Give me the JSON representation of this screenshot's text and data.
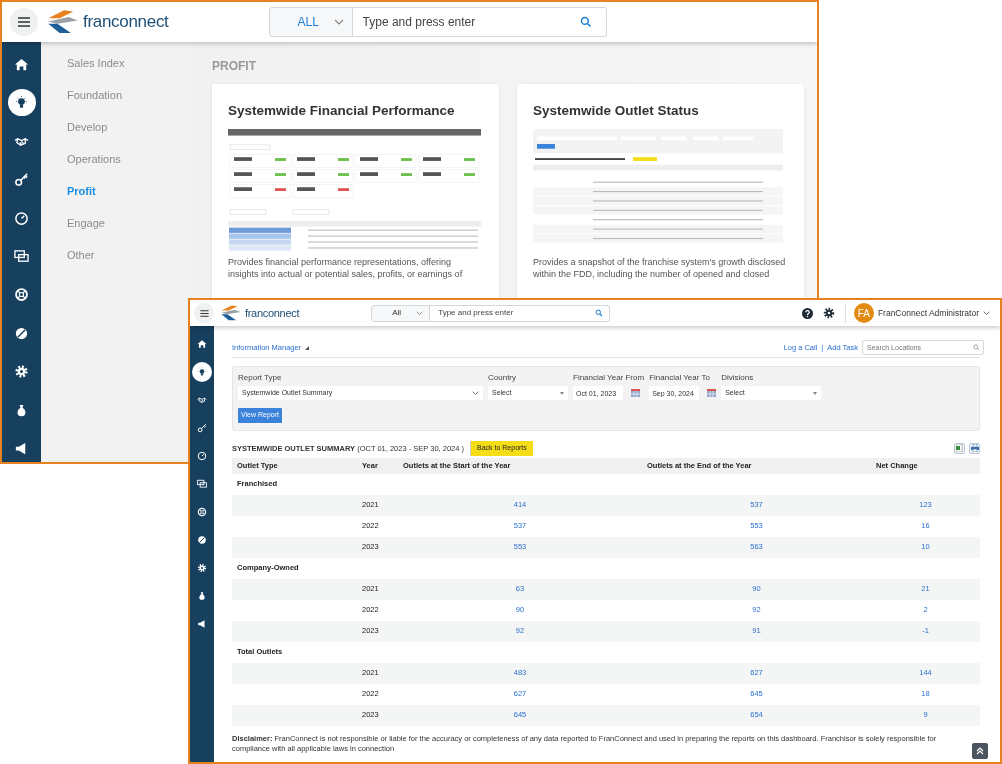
{
  "back_window": {
    "logo_text": "franconnect",
    "search": {
      "scope": "ALL",
      "placeholder": "Type and press enter"
    },
    "sidebar": [
      {
        "selected": false
      },
      {
        "selected": true
      },
      {
        "selected": false
      },
      {
        "selected": false
      },
      {
        "selected": false
      },
      {
        "selected": false
      },
      {
        "selected": false
      },
      {
        "selected": false
      },
      {
        "selected": false
      },
      {
        "selected": false
      },
      {
        "selected": false
      }
    ],
    "nav": [
      {
        "label": "Sales Index",
        "selected": false
      },
      {
        "label": "Foundation",
        "selected": false
      },
      {
        "label": "Develop",
        "selected": false
      },
      {
        "label": "Operations",
        "selected": false
      },
      {
        "label": "Profit",
        "selected": true
      },
      {
        "label": "Engage",
        "selected": false
      },
      {
        "label": "Other",
        "selected": false
      }
    ],
    "section_title": "PROFIT",
    "cards": [
      {
        "title": "Systemwide Financial Performance",
        "kind": "kpi",
        "description": "Provides financial performance representations, offering insights into actual or potential sales, profits, or earnings of"
      },
      {
        "title": "Systemwide Outlet Status",
        "kind": "table",
        "description": "Provides a snapshot of the franchise system's growth disclosed within the FDD, including the number of opened and closed"
      }
    ]
  },
  "front_window": {
    "logo_text": "franconnect",
    "search": {
      "scope": "All",
      "placeholder": "Type and press enter"
    },
    "user": {
      "initials": "FA",
      "name": "FranConnect Administrator"
    },
    "sidebar": [
      {
        "selected": false
      },
      {
        "selected": true
      },
      {
        "selected": false
      },
      {
        "selected": false
      },
      {
        "selected": false
      },
      {
        "selected": false
      },
      {
        "selected": false
      },
      {
        "selected": false
      },
      {
        "selected": false
      },
      {
        "selected": false
      },
      {
        "selected": false
      }
    ],
    "breadcrumb": "Information Manager",
    "links": [
      "Log a Call",
      "Add Task"
    ],
    "link_separator": "|",
    "location_search": {
      "placeholder": "Search Locations"
    },
    "filters": [
      {
        "kind": "select",
        "label": "Report Type",
        "value": "Systemwide Outlet Summary"
      },
      {
        "kind": "select",
        "label": "Country",
        "value": "Select"
      },
      {
        "kind": "date",
        "label": "Financial Year From",
        "value": "Oct 01, 2023"
      },
      {
        "kind": "date",
        "label": "Financial Year To",
        "value": "Sep 30, 2024"
      },
      {
        "kind": "select",
        "label": "Divisions",
        "value": "Select"
      }
    ],
    "view_button": "View Report",
    "report_title": "**SYSTEMWIDE OUTLET SUMMARY** (OCT 01, 2023 - SEP 30, 2024 )",
    "back_button": "Back to Reports",
    "table": {
      "columns": [
        "Outlet Type",
        "Year",
        "Outlets at the Start of the Year",
        "Outlets at the End of the Year",
        "Net Change"
      ],
      "groups": [
        {
          "label": "Franchised",
          "rows": [
            [
              "2021",
              "414",
              "537",
              "123"
            ],
            [
              "2022",
              "537",
              "553",
              "16"
            ],
            [
              "2023",
              "553",
              "563",
              "10"
            ]
          ]
        },
        {
          "label": "Company-Owned",
          "rows": [
            [
              "2021",
              "63",
              "90",
              "21"
            ],
            [
              "2022",
              "90",
              "92",
              "2"
            ],
            [
              "2023",
              "92",
              "91",
              "-1"
            ]
          ]
        },
        {
          "label": "Total Outlets",
          "rows": [
            [
              "2021",
              "483",
              "627",
              "144"
            ],
            [
              "2022",
              "627",
              "645",
              "18"
            ],
            [
              "2023",
              "645",
              "654",
              "9"
            ]
          ]
        }
      ]
    },
    "disclaimer": "**Disclaimer:** FranConnect is not responsible or liable for the accuracy or completeness of any data reported to FranConnect and used in preparing the reports on this dashboard. Franchisor is solely responsible for compliance with all applicable laws in connection"
  }
}
